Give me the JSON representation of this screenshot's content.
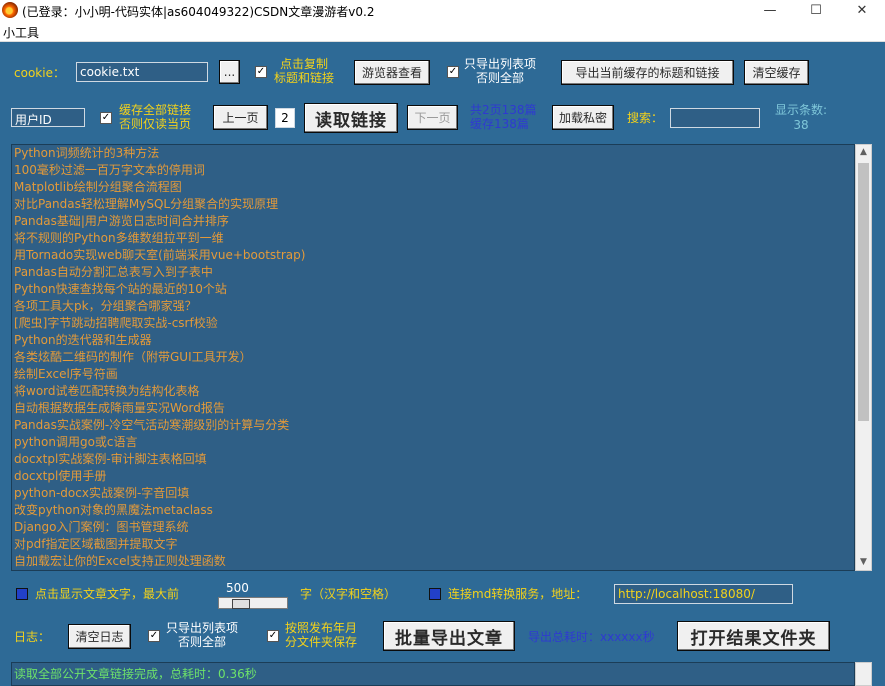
{
  "window": {
    "title": "(已登录：小小明-代码实体|as604049322)CSDN文章漫游者v0.2",
    "minimize": "—",
    "maximize": "☐",
    "close": "✕"
  },
  "menu": {
    "tools": "小工具"
  },
  "row1": {
    "cookie_label": "cookie：",
    "cookie_value": "cookie.txt",
    "browse": "...",
    "copy_check_line1": "点击复制",
    "copy_check_line2": "标题和链接",
    "browser_view": "游览器查看",
    "export_list_line1": "只导出列表项",
    "export_list_line2": "否则全部",
    "export_cache": "导出当前缓存的标题和链接",
    "clear_cache": "清空缓存"
  },
  "row2": {
    "user_id_value": "用户ID",
    "cache_all_line1": "缓存全部链接",
    "cache_all_line2": "否则仅读当页",
    "prev_page": "上一页",
    "page_number": "2",
    "read_links": "读取链接",
    "next_page": "下一页",
    "total_info": "共2页138篇",
    "cache_info": "缓存138篇",
    "load_private": "加载私密",
    "search_label": "搜索：",
    "search_value": "",
    "display_count_label": "显示条数:",
    "display_count_value": "38"
  },
  "articles": [
    "Python词频统计的3种方法",
    "100毫秒过滤一百万字文本的停用词",
    "Matplotlib绘制分组聚合流程图",
    "对比Pandas轻松理解MySQL分组聚合的实现原理",
    "Pandas基础|用户游览日志时间合并排序",
    "将不规则的Python多维数组拉平到一维",
    "用Tornado实现web聊天室(前端采用vue+bootstrap)",
    "Pandas自动分割汇总表写入到子表中",
    "Python快速查找每个站的最近的10个站",
    "各项工具大pk，分组聚合哪家强？",
    "[爬虫]字节跳动招聘爬取实战-csrf校验",
    "Python的迭代器和生成器",
    "各类炫酷二维码的制作（附带GUI工具开发）",
    "绘制Excel序号符画",
    "将word试卷匹配转换为结构化表格",
    "自动根据数据生成降雨量实况Word报告",
    "Pandas实战案例-冷空气活动寒潮级别的计算与分类",
    "python调用go或c语言",
    "docxtpl实战案例-审计脚注表格回填",
    "docxtpl使用手册",
    "python-docx实战案例-字音回填",
    "改变python对象的黑魔法metaclass",
    "Django入门案例：图书管理系统",
    "对pdf指定区域截图并提取文字",
    "自加载宏让你的Excel支持正则处理函数"
  ],
  "row3": {
    "show_text_label": "点击显示文章文字，最大前",
    "slider_value": "500",
    "slider_fraction": 0.25,
    "chars_label": "字（汉字和空格）",
    "md_service_label": "连接md转换服务，地址：",
    "md_url": "http://localhost:18080/"
  },
  "row4": {
    "log_label": "日志：",
    "clear_log": "清空日志",
    "export_list_line1": "只导出列表项",
    "export_list_line2": "否则全部",
    "by_date_line1": "按照发布年月",
    "by_date_line2": "分文件夹保存",
    "batch_export": "批量导出文章",
    "export_time": "导出总耗时：xxxxxx秒",
    "open_folder": "打开结果文件夹"
  },
  "status": {
    "text": "读取全部公开文章链接完成，总耗时：0.36秒"
  },
  "colors": {
    "background": "#2e6a96",
    "label": "#f3d21b",
    "list_text": "#e39a3a",
    "status_text": "#6ee26a",
    "info_text": "#2f3ad0"
  }
}
